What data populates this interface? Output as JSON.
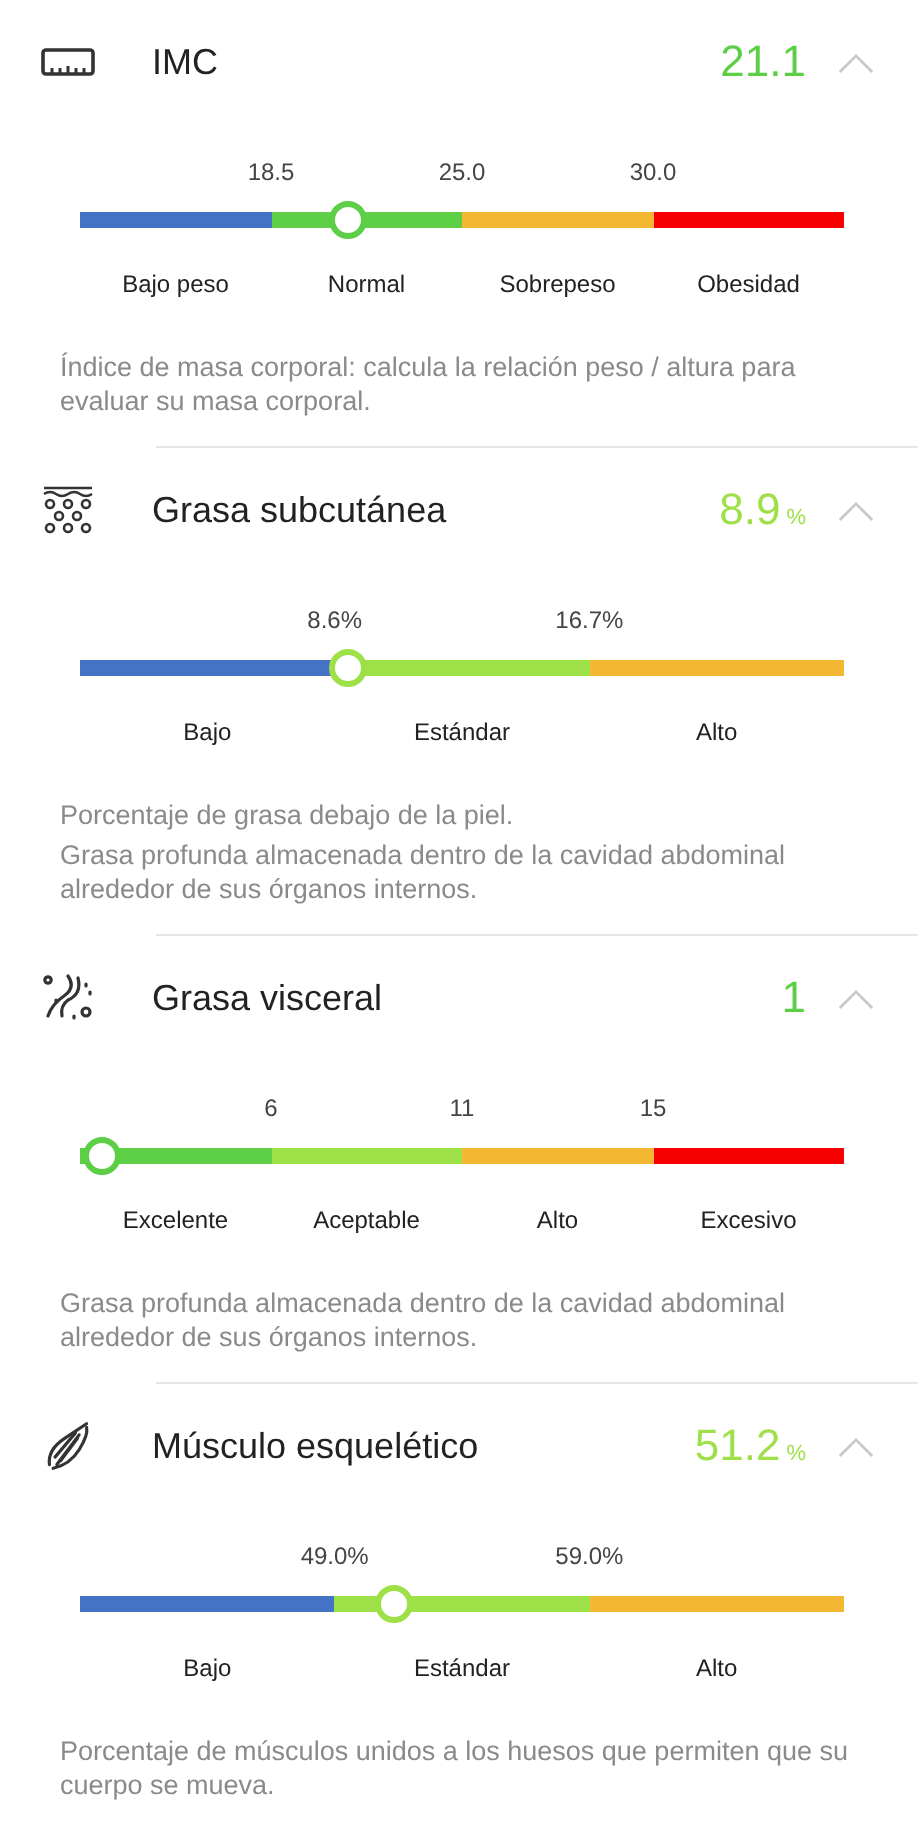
{
  "metrics": [
    {
      "title": "IMC",
      "value": "21.1",
      "level": 0.35,
      "expanded": true,
      "thresholds": [
        "18.5",
        "25.0",
        "30.0"
      ],
      "segments": [
        {
          "label": "Bajo peso",
          "color": "#4472c4"
        },
        {
          "label": "Normal",
          "color": "#5ccf46"
        },
        {
          "label": "Sobrepeso",
          "color": "#f4b731"
        },
        {
          "label": "Obesidad",
          "color": "#f50000"
        }
      ],
      "description": [
        "Índice de masa corporal: calcula la relación peso / altura para evaluar su masa corporal."
      ]
    },
    {
      "title": "Grasa subcutánea",
      "value": "8.9",
      "unit": "%",
      "level": 0.35,
      "expanded": true,
      "thresholds": [
        "8.6%",
        "16.7%"
      ],
      "segments": [
        {
          "label": "Bajo",
          "color": "#4472c4"
        },
        {
          "label": "Estándar",
          "color": "#9ee048"
        },
        {
          "label": "Alto",
          "color": "#f4b731"
        }
      ],
      "description": [
        "Porcentaje de grasa debajo de la piel.",
        "Grasa profunda almacenada dentro de la cavidad abdominal alrededor de sus órganos internos."
      ]
    },
    {
      "title": "Grasa visceral",
      "value": "1",
      "level": 0.03,
      "expanded": true,
      "thresholds": [
        "6",
        "11",
        "15"
      ],
      "segments": [
        {
          "label": "Excelente",
          "color": "#5ccf46"
        },
        {
          "label": "Aceptable",
          "color": "#9ee048"
        },
        {
          "label": "Alto",
          "color": "#f4b731"
        },
        {
          "label": "Excesivo",
          "color": "#f50000"
        }
      ],
      "description": [
        "Grasa profunda almacenada dentro de la cavidad abdominal alrededor de sus órganos internos."
      ]
    },
    {
      "title": "Músculo esquelético",
      "value": "51.2",
      "unit": "%",
      "level": 0.41,
      "expanded": true,
      "thresholds": [
        "49.0%",
        "59.0%"
      ],
      "segments": [
        {
          "label": "Bajo",
          "color": "#4472c4"
        },
        {
          "label": "Estándar",
          "color": "#9ee048"
        },
        {
          "label": "Alto",
          "color": "#f4b731"
        }
      ],
      "description": [
        "Porcentaje de músculos unidos a los huesos que permiten que su cuerpo se mueva."
      ]
    }
  ]
}
